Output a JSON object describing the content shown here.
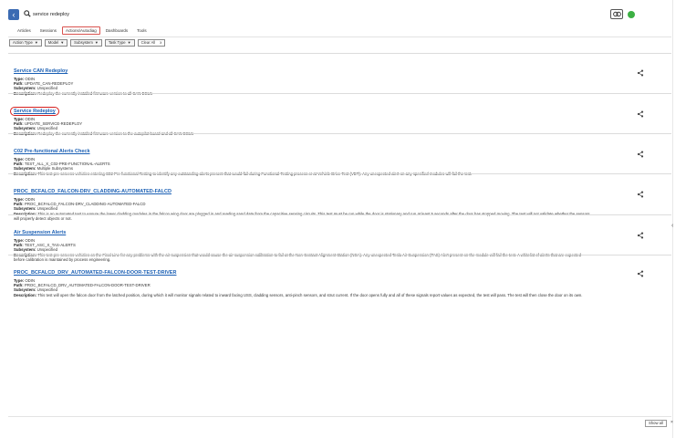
{
  "search": {
    "query": "service redeploy"
  },
  "tabs": [
    {
      "label": "Articles"
    },
    {
      "label": "Sessions"
    },
    {
      "label": "Actions/Autodiag"
    },
    {
      "label": "Dashboards"
    },
    {
      "label": "Tools"
    }
  ],
  "active_tab": "Actions/Autodiag",
  "filters": [
    {
      "label": "Action Type"
    },
    {
      "label": "Model"
    },
    {
      "label": "Subsystem"
    },
    {
      "label": "Task Type"
    }
  ],
  "clear_all": {
    "label": "Clear All",
    "icon": "x"
  },
  "field_labels": {
    "type": "Type:",
    "path": "Path:",
    "subsystem": "Subsystem:",
    "description": "Description:"
  },
  "results": [
    {
      "title": "Service CAN Redeploy",
      "type": "ODIN",
      "path": "UPDATE_CAN-REDEPLOY",
      "subsystem": "Unspecified",
      "description": "Redeploy the currently installed firmware version to all CAN ECUs"
    },
    {
      "title": "Service Redeploy",
      "highlighted": true,
      "type": "ODIN",
      "path": "UPDATE_SERVICE-REDEPLOY",
      "subsystem": "Unspecified",
      "description": "Redeploy the currently installed firmware version to the autopilot board and all CAN ECUs"
    },
    {
      "title": "C02 Pre-functional Alerts Check",
      "type": "ODIN",
      "path": "TEST_ALL_X_C02-PRE-FUNCTIONAL-ALERTS",
      "subsystem": "Multiple Subsystems",
      "description": "This test pre-screens vehicles entering C02 Pre-functional Testing to identify any outstanding alerts present that would fail during Functional Testing process or at Vehicle Drive Test (VDT). Any unexpected alert on any specified modules will fail the test."
    },
    {
      "title": "PROC_BCFALCD_FALCON-DRV_CLADDING-AUTOMATED-FALCD",
      "type": "ODIN",
      "path": "PROC_BCFALCD_FALCON-DRV_CLADDING-AUTOMATED-FALCD",
      "subsystem": "Unspecified",
      "description": "This is an automated test to ensure the lower cladding modules in the falcon wing door are plugged in and reading sand data from the capacitive sensing circuits. This test must be run while the door is stationary and run at least 5 seconds after the door has stopped moving. The test will not validate whether the sensors will properly detect objects or not."
    },
    {
      "title": "Air Suspension Alerts",
      "type": "ODIN",
      "path": "TEST_ASC_X_TAS-ALERTS",
      "subsystem": "Unspecified",
      "description": "This test pre-screens vehicles on the Final Line for any problems with the air suspension that would cause the air suspension calibration to fail at the Non-Contact Alignment Station (NCA). Any unexpected Tesla Air Suspension (TAS) Alert present on the module will fail the test. A whitelist of alerts that are expected before calibration is maintained by process engineering."
    },
    {
      "title": "PROC_BCFALCD_DRV_AUTOMATED-FALCON-DOOR-TEST-DRIVER",
      "type": "ODIN",
      "path": "PROC_BCFALCD_DRV_AUTOMATED-FALCON-DOOR-TEST-DRIVER",
      "subsystem": "Unspecified",
      "description": "This test will open the falcon door from the latched position, during which it will monitor signals related to inward facing USS, cladding sensors, anti-pinch sensors, and strut current. If the door opens fully and all of these signals report values as expected, the test will pass. The test will then close the door on its own."
    }
  ],
  "footer": {
    "show_all_label": "Show all",
    "close_icon": "×"
  },
  "colors": {
    "accent": "#3b6bb3",
    "link": "#1a5fb4",
    "highlight": "#d6201e",
    "status": "#3cb043"
  }
}
